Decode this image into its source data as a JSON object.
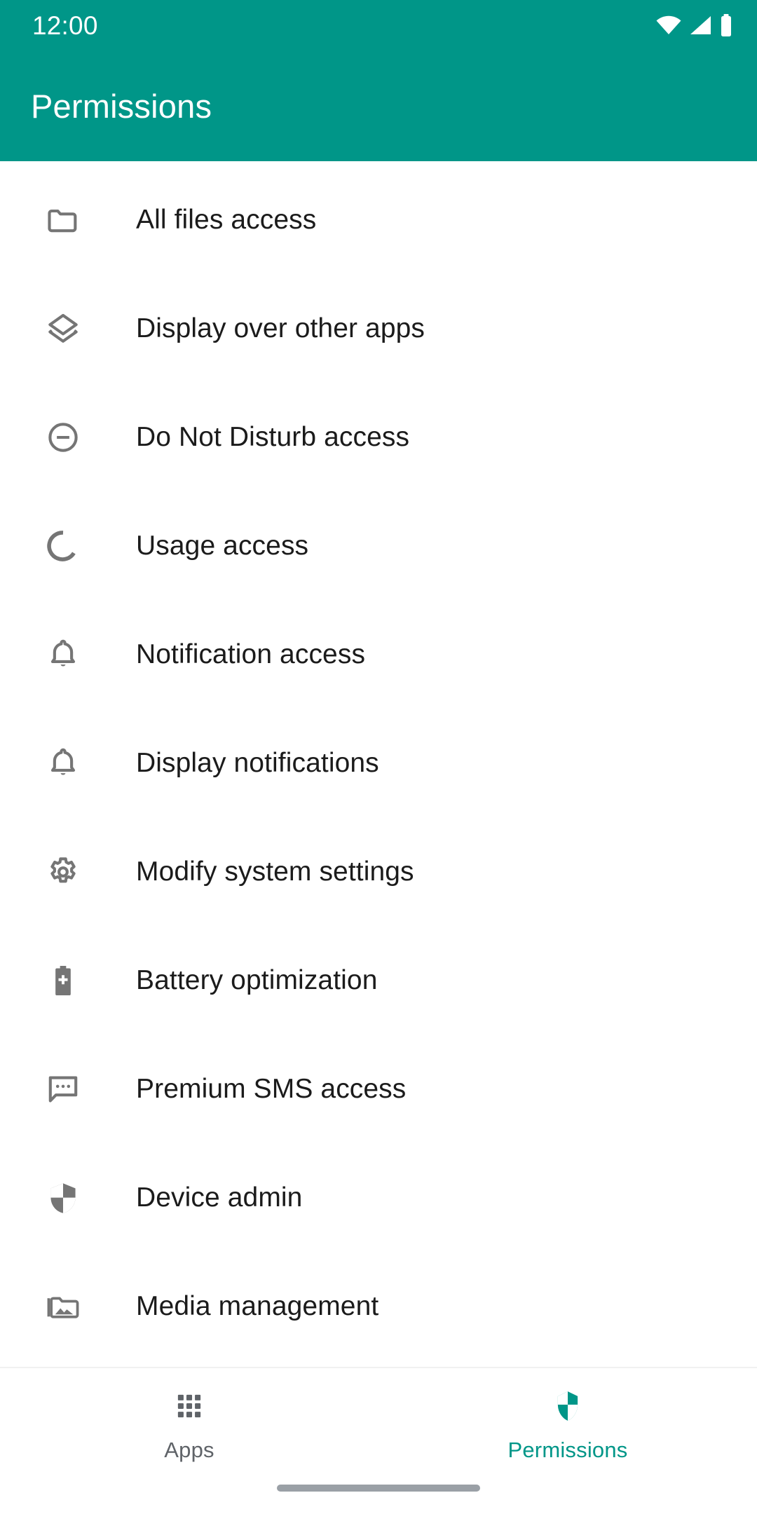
{
  "theme": {
    "accent": "#009688",
    "icon_gray": "#757575",
    "text_primary": "#1b1b1b",
    "nav_inactive": "#5f6368",
    "divider": "#f1f1f1"
  },
  "status_bar": {
    "time": "12:00",
    "icons": [
      "wifi-icon",
      "cellular-signal-icon",
      "battery-icon"
    ]
  },
  "app_bar": {
    "title": "Permissions"
  },
  "permissions": {
    "items": [
      {
        "label": "All files access",
        "icon": "folder-icon"
      },
      {
        "label": "Display over other apps",
        "icon": "layers-icon"
      },
      {
        "label": "Do Not Disturb access",
        "icon": "do-not-disturb-icon"
      },
      {
        "label": "Usage access",
        "icon": "donut-usage-icon"
      },
      {
        "label": "Notification access",
        "icon": "bell-icon"
      },
      {
        "label": "Display notifications",
        "icon": "bell-icon"
      },
      {
        "label": "Modify system settings",
        "icon": "gear-icon"
      },
      {
        "label": "Battery optimization",
        "icon": "battery-plus-icon"
      },
      {
        "label": "Premium SMS access",
        "icon": "sms-bubble-icon"
      },
      {
        "label": "Device admin",
        "icon": "shield-icon"
      },
      {
        "label": "Media management",
        "icon": "folder-media-icon"
      }
    ]
  },
  "bottom_nav": {
    "items": [
      {
        "label": "Apps",
        "icon": "apps-grid-icon",
        "active": false
      },
      {
        "label": "Permissions",
        "icon": "shield-icon",
        "active": true
      }
    ]
  }
}
